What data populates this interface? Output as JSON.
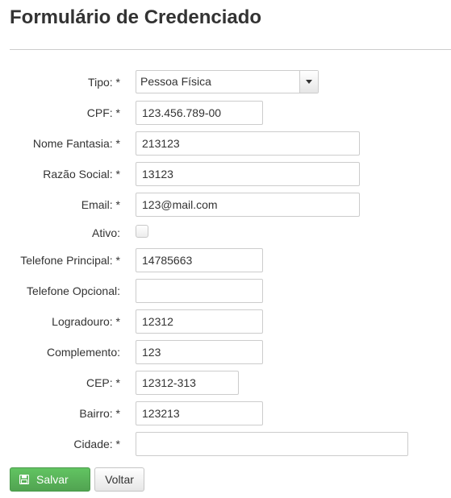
{
  "page": {
    "title": "Formulário de Credenciado"
  },
  "form": {
    "tipo": {
      "label": "Tipo: *",
      "value": "Pessoa Física"
    },
    "cpf": {
      "label": "CPF: *",
      "value": "123.456.789-00"
    },
    "nome_fantasia": {
      "label": "Nome Fantasia: *",
      "value": "213123"
    },
    "razao_social": {
      "label": "Razão Social: *",
      "value": "13123"
    },
    "email": {
      "label": "Email: *",
      "value": "123@mail.com"
    },
    "ativo": {
      "label": "Ativo:",
      "checked": false
    },
    "telefone_principal": {
      "label": "Telefone Principal: *",
      "value": "14785663"
    },
    "telefone_opcional": {
      "label": "Telefone Opcional:",
      "value": ""
    },
    "logradouro": {
      "label": "Logradouro: *",
      "value": "12312"
    },
    "complemento": {
      "label": "Complemento:",
      "value": "123"
    },
    "cep": {
      "label": "CEP: *",
      "value": "12312-313"
    },
    "bairro": {
      "label": "Bairro: *",
      "value": "123213"
    },
    "cidade": {
      "label": "Cidade: *",
      "value": ""
    }
  },
  "actions": {
    "save_label": "Salvar",
    "save_icon": "floppy-disk-icon",
    "back_label": "Voltar"
  },
  "colors": {
    "save_button": "#5cb85c",
    "border": "#cccccc",
    "text": "#333333"
  }
}
